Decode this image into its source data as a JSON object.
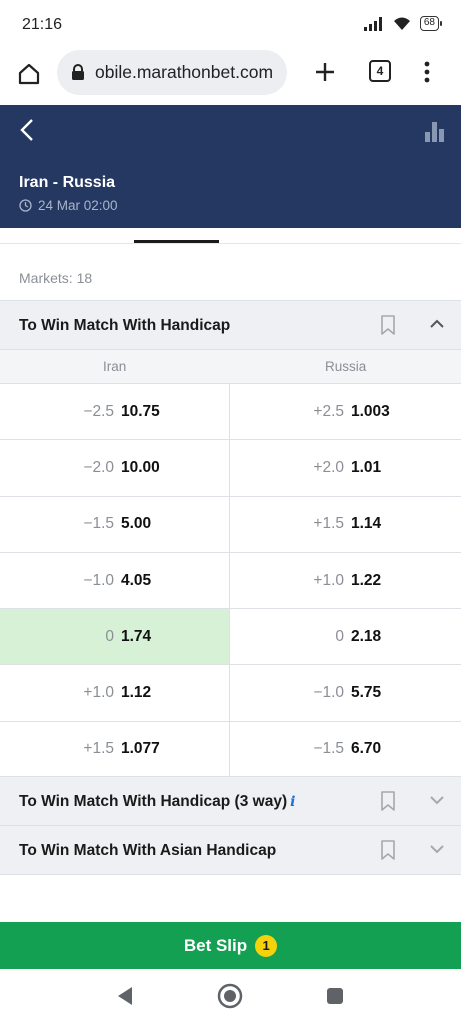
{
  "status": {
    "time": "21:16",
    "battery": "68"
  },
  "browser": {
    "url": "obile.marathonbet.com",
    "tab_count": "4"
  },
  "event": {
    "title": "Iran - Russia",
    "datetime": "24 Mar 02:00"
  },
  "markets_count": "Markets: 18",
  "market_primary": {
    "title": "To Win Match With Handicap",
    "col_left": "Iran",
    "col_right": "Russia",
    "rows": [
      {
        "left_hc": "−2.5",
        "left_odd": "10.75",
        "right_hc": "+2.5",
        "right_odd": "1.003",
        "left_selected": false
      },
      {
        "left_hc": "−2.0",
        "left_odd": "10.00",
        "right_hc": "+2.0",
        "right_odd": "1.01",
        "left_selected": false
      },
      {
        "left_hc": "−1.5",
        "left_odd": "5.00",
        "right_hc": "+1.5",
        "right_odd": "1.14",
        "left_selected": false
      },
      {
        "left_hc": "−1.0",
        "left_odd": "4.05",
        "right_hc": "+1.0",
        "right_odd": "1.22",
        "left_selected": false
      },
      {
        "left_hc": "0",
        "left_odd": "1.74",
        "right_hc": "0",
        "right_odd": "2.18",
        "left_selected": true
      },
      {
        "left_hc": "+1.0",
        "left_odd": "1.12",
        "right_hc": "−1.0",
        "right_odd": "5.75",
        "left_selected": false
      },
      {
        "left_hc": "+1.5",
        "left_odd": "1.077",
        "right_hc": "−1.5",
        "right_odd": "6.70",
        "left_selected": false
      }
    ]
  },
  "market_3way": {
    "title": "To Win Match With Handicap (3 way)",
    "info": "i"
  },
  "market_asian": {
    "title": "To Win Match With Asian Handicap"
  },
  "betslip": {
    "label": "Bet Slip",
    "count": "1"
  },
  "colors": {
    "navy": "#253861",
    "green": "#14a052",
    "selected": "#d7f1d6",
    "badge": "#f5d20b"
  },
  "icons": [
    "home-icon",
    "lock-icon",
    "plus-icon",
    "tabs-icon",
    "more-icon",
    "back-icon",
    "stats-icon",
    "clock-icon",
    "bookmark-icon",
    "chevron-up-icon",
    "chevron-down-icon",
    "nav-back-icon",
    "nav-home-icon",
    "nav-recents-icon"
  ]
}
